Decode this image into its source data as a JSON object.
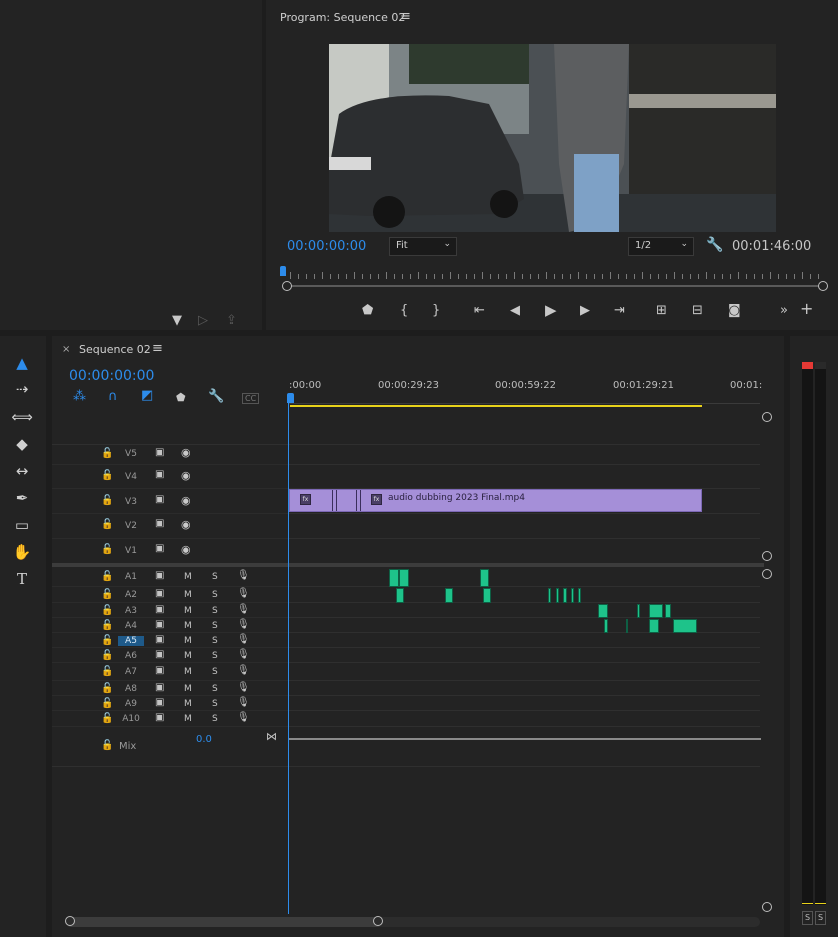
{
  "program": {
    "title": "Program: Sequence 02",
    "timecode": "00:00:00:00",
    "fit": "Fit",
    "resolution": "1/2",
    "duration": "00:01:46:00"
  },
  "timeline": {
    "tab": "Sequence 02",
    "timecode": "00:00:00:00",
    "ruler": [
      ":00:00",
      "00:00:29:23",
      "00:00:59:22",
      "00:01:29:21",
      "00:01:"
    ],
    "clip_name": "audio dubbing 2023 Final.mp4",
    "video_tracks": [
      "V5",
      "V4",
      "V3",
      "V2",
      "V1"
    ],
    "audio_tracks": [
      "A1",
      "A2",
      "A3",
      "A4",
      "A5",
      "A6",
      "A7",
      "A8",
      "A9",
      "A10"
    ],
    "mix_label": "Mix",
    "mix_value": "0.0",
    "m": "M",
    "s": "S",
    "cc": "CC"
  },
  "meter": {
    "solo_left": "S",
    "solo_right": "S"
  },
  "colors": {
    "accent": "#2d8ceb",
    "clip_video": "#a58fd8",
    "clip_audio": "#1ec38a",
    "work_area": "#e8d21a",
    "meter_red": "#e53935"
  }
}
